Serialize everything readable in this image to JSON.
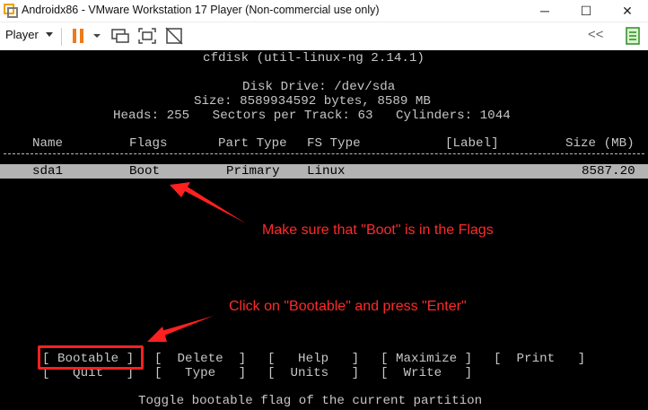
{
  "window": {
    "title": "Androidx86 - VMware Workstation 17 Player (Non-commercial use only)",
    "minimize": "─",
    "maximize": "☐",
    "close": "✕"
  },
  "toolbar": {
    "player_label": "Player",
    "collapse_glyph": "<<"
  },
  "terminal": {
    "program_title": "cfdisk (util-linux-ng 2.14.1)",
    "disk_drive": "Disk Drive: /dev/sda",
    "size_line": "Size: 8589934592 bytes, 8589 MB",
    "geometry_line": "Heads: 255   Sectors per Track: 63   Cylinders: 1044",
    "columns": {
      "name": "Name",
      "flags": "Flags",
      "part_type": "Part Type",
      "fs_type": "FS Type",
      "label": "[Label]",
      "size": "Size (MB)"
    },
    "row": {
      "name": "sda1",
      "flags": "Boot",
      "part_type": "Primary",
      "fs_type": "Linux",
      "size": "8587.20"
    },
    "menu": {
      "bootable": "[ Bootable ]",
      "delete": "[  Delete  ]",
      "help": "[   Help   ]",
      "maximize": "[ Maximize ]",
      "print": "[  Print   ]",
      "quit": "[   Quit   ]",
      "type": "[   Type   ]",
      "units": "[  Units   ]",
      "write": "[  Write   ]"
    },
    "status_line": "Toggle bootable flag of the current partition"
  },
  "annotations": {
    "flags_note": "Make sure that \"Boot\" is in the Flags",
    "enter_note": "Click on \"Bootable\" and press \"Enter\"",
    "color": "#ff2a2a"
  }
}
